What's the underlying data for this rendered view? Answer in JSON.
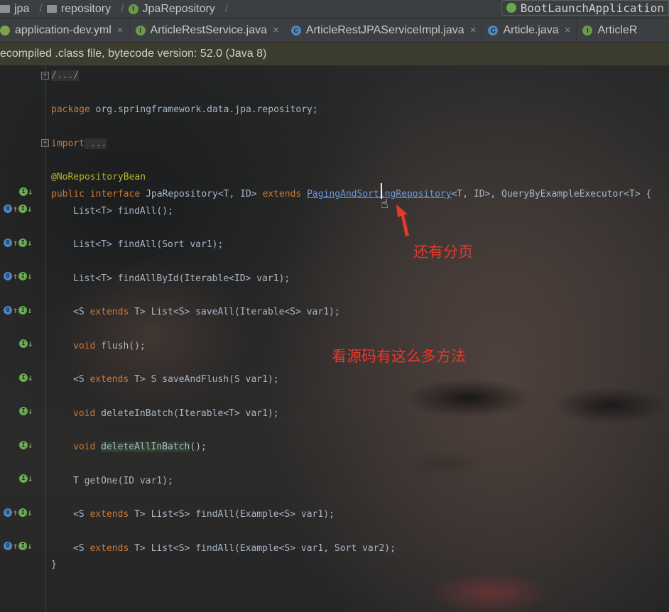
{
  "breadcrumb": {
    "items": [
      "jpa",
      "repository",
      "JpaRepository"
    ]
  },
  "run_config": {
    "label": "BootLaunchApplication"
  },
  "tabs": [
    {
      "label": "application-dev.yml",
      "icon": "yaml-file-icon",
      "closable": true
    },
    {
      "label": "ArticleRestService.java",
      "icon": "interface-icon",
      "closable": true
    },
    {
      "label": "ArticleRestJPAServiceImpl.java",
      "icon": "class-icon",
      "closable": true
    },
    {
      "label": "Article.java",
      "icon": "class-icon",
      "closable": true
    },
    {
      "label": "ArticleR",
      "icon": "interface-icon",
      "closable": false
    }
  ],
  "notice": {
    "text": "ecompiled .class file, bytecode version: 52.0 (Java 8)"
  },
  "code": {
    "folded_header": "/.../",
    "package_kw": "package",
    "package_name": " org.springframework.data.jpa.repository;",
    "import_kw": "import",
    "import_fold": " ...",
    "annotation": "@NoRepositoryBean",
    "decl": {
      "kw1": "public",
      "kw2": " interface",
      "name": " JpaRepository<T, ID> ",
      "kw3": "extends",
      "link": "PagingAndSortingRepository",
      "rest": "<T, ID>, QueryByExampleExecutor<T> {"
    },
    "methods": [
      "List<T> findAll();",
      "List<T> findAll(Sort var1);",
      "List<T> findAllById(Iterable<ID> var1);",
      "<S extends T> List<S> saveAll(Iterable<S> var1);",
      "void flush();",
      "<S extends T> S saveAndFlush(S var1);",
      "void deleteInBatch(Iterable<T> var1);",
      "void deleteAllInBatch();",
      "T getOne(ID var1);",
      "<S extends T> List<S> findAll(Example<S> var1);",
      "<S extends T> List<S> findAll(Example<S> var1, Sort var2);"
    ],
    "closing": "}"
  },
  "annotations": {
    "paging_note": "还有分页",
    "methods_note": "看源码有这么多方法"
  },
  "colors": {
    "keyword": "#cc7832",
    "annotation": "#bbb529",
    "link": "#6a9bd8",
    "note": "#e8382a"
  }
}
